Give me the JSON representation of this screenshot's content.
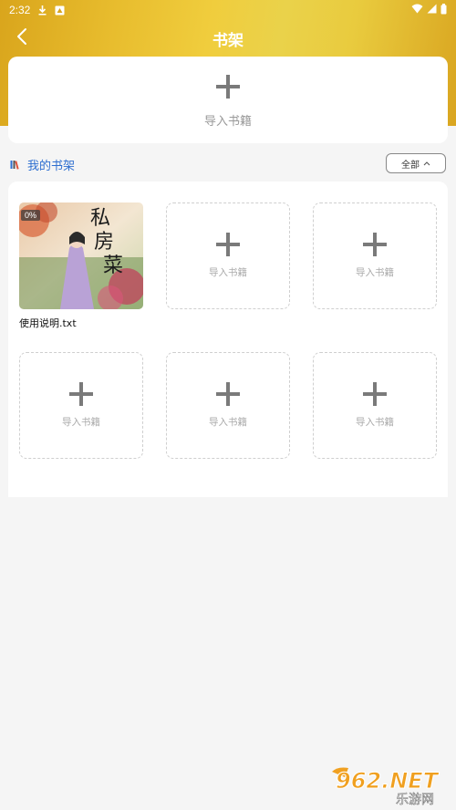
{
  "status_bar": {
    "time": "2:32"
  },
  "nav": {
    "title": "书架"
  },
  "import_card": {
    "label": "导入书籍"
  },
  "section": {
    "title": "我的书架",
    "filter_label": "全部"
  },
  "books": [
    {
      "name": "使用说明.txt",
      "progress": "0%",
      "cover_title": "私房菜"
    }
  ],
  "empty_slots": [
    {
      "label": "导入书籍"
    },
    {
      "label": "导入书籍"
    },
    {
      "label": "导入书籍"
    },
    {
      "label": "导入书籍"
    },
    {
      "label": "导入书籍"
    }
  ],
  "watermark": {
    "line1": "962.NET",
    "line2": "乐游网"
  },
  "colors": {
    "accent": "#2f6fd0",
    "header_gold": "#e8bd2e"
  }
}
